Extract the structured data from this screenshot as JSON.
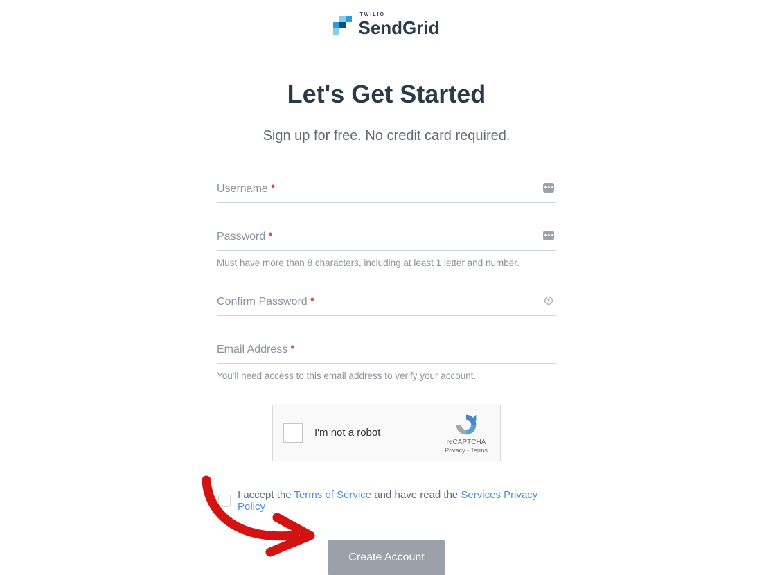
{
  "logo": {
    "small_text": "TWILIO",
    "main_text": "SendGrid"
  },
  "heading": "Let's Get Started",
  "subheading": "Sign up for free. No credit card required.",
  "fields": {
    "username": {
      "label": "Username"
    },
    "password": {
      "label": "Password",
      "helper": "Must have more than 8 characters, including at least 1 letter and number."
    },
    "confirm_password": {
      "label": "Confirm Password"
    },
    "email": {
      "label": "Email Address",
      "helper": "You'll need access to this email address to verify your account."
    }
  },
  "recaptcha": {
    "label": "I'm not a robot",
    "brand": "reCAPTCHA",
    "privacy": "Privacy",
    "terms": "Terms"
  },
  "terms": {
    "prefix": "I accept the ",
    "tos": "Terms of Service",
    "middle": " and have read the ",
    "privacy": "Services Privacy Policy"
  },
  "submit_label": "Create Account"
}
